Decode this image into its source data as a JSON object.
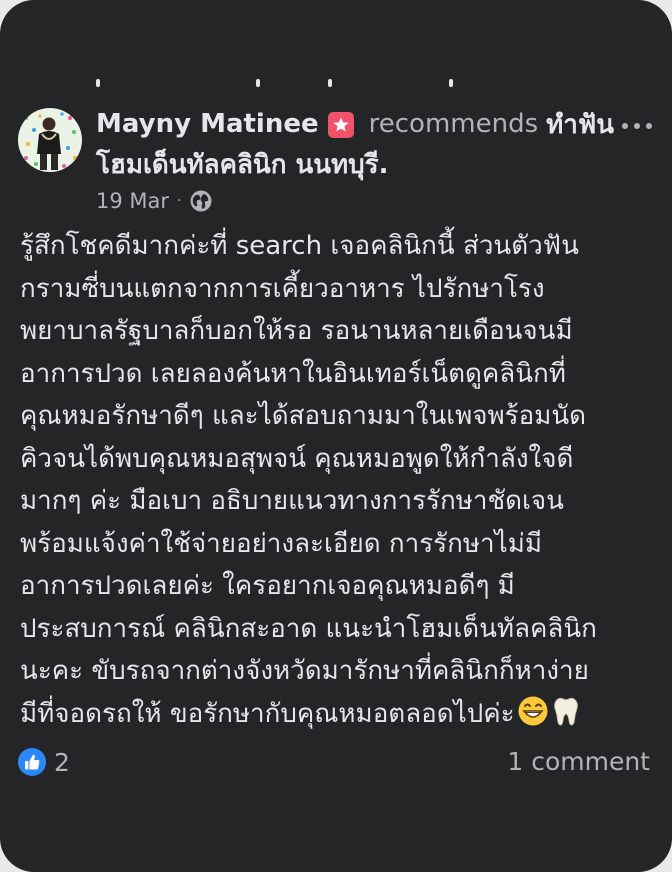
{
  "post": {
    "author": "Mayny Matinee",
    "action": "recommends",
    "page_name_part1": "ทำฟัน",
    "page_name_part2": "โฮมเด็นทัลคลินิก นนทบุรี.",
    "date": "19 Mar",
    "separator": "·",
    "body_lines": [
      "รู้สึกโชคดีมากค่ะที่ search เจอคลินิกนี้ ส่วนตัวฟัน",
      "กรามซี่บนแตกจากการเคี้ยวอาหาร ไปรักษาโรง",
      "พยาบาลรัฐบาลก็บอกให้รอ รอนานหลายเดือนจนมี",
      "อาการปวด เลยลองค้นหาในอินเทอร์เน็ตดูคลินิกที่",
      "คุณหมอรักษาดีๆ และได้สอบถามมาในเพจพร้อมนัด",
      "คิวจนได้พบคุณหมอสุพจน์ คุณหมอพูดให้กำลังใจดี",
      "มากๆ ค่ะ มือเบา อธิบายแนวทางการรักษาชัดเจน",
      "พร้อมแจ้งค่าใช้จ่ายอย่างละเอียด การรักษาไม่มี",
      "อาการปวดเลยค่ะ ใครอยากเจอคุณหมอดีๆ มี",
      "ประสบการณ์ คลินิกสะอาด แนะนำโฮมเด็นทัลคลินิก",
      "นะคะ ขับรถจากต่างจังหวัดมารักษาที่คลินิกก็หาง่าย",
      "มีที่จอดรถให้ ขอรักษากับคุณหมอตลอดไปค่ะ"
    ],
    "likes": "2",
    "comments": "1 comment"
  },
  "icons": {
    "badge": "star-badge-icon",
    "more": "more-options-icon",
    "privacy": "globe-icon",
    "like": "like-thumb-icon",
    "emoji1": "grinning-face-emoji",
    "emoji2": "tooth-emoji"
  },
  "colors": {
    "background": "#242526",
    "primary_text": "#e4e6eb",
    "secondary_text": "#b0b3b8",
    "badge": "#f25268",
    "like": "#2d88ff"
  }
}
